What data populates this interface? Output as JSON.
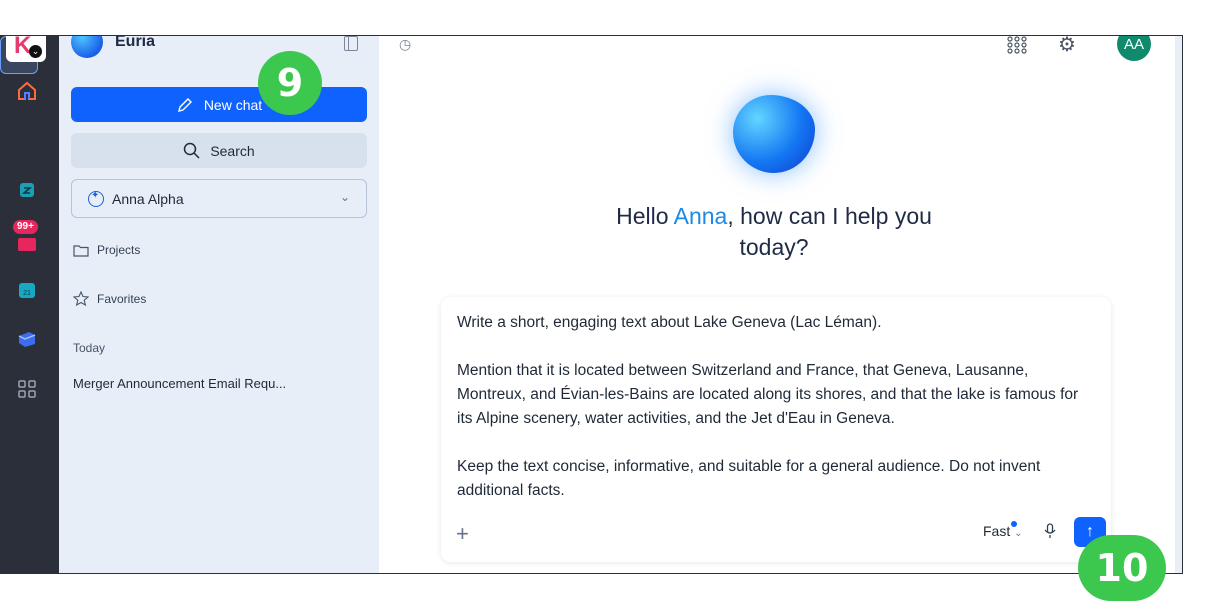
{
  "rail": {
    "badge": "99+",
    "items": [
      "home-icon",
      "euria-icon",
      "drive-icon",
      "mail-icon",
      "calendar-icon",
      "kchat-icon",
      "apps-grid-icon"
    ]
  },
  "sidebar": {
    "brand": "Euria",
    "new_chat": "New chat",
    "search": "Search",
    "assistant": "Anna Alpha",
    "projects": "Projects",
    "favorites": "Favorites",
    "section_today": "Today",
    "conversations": [
      "Merger Announcement Email Requ..."
    ]
  },
  "main": {
    "greeting_before": "Hello ",
    "greeting_name": "Anna",
    "greeting_after": ", how can I help you today?",
    "avatar": "AA",
    "prompt_paragraphs": [
      "Write a short, engaging text about Lake Geneva (Lac Léman).",
      "Mention that it is located between Switzerland and France, that Geneva, Lausanne, Montreux, and Évian-les-Bains are located along its shores, and that the lake is famous for its Alpine scenery, water activities, and the Jet d'Eau in Geneva.",
      "Keep the text concise, informative, and suitable for a general audience. Do not invent additional facts."
    ],
    "mode": "Fast"
  },
  "markers": {
    "step_a": "9",
    "step_b": "10"
  },
  "colors": {
    "accent": "#0f62fe",
    "marker": "#3cc84f",
    "rail": "#2b2f39",
    "sidebar": "#e7eef8"
  }
}
